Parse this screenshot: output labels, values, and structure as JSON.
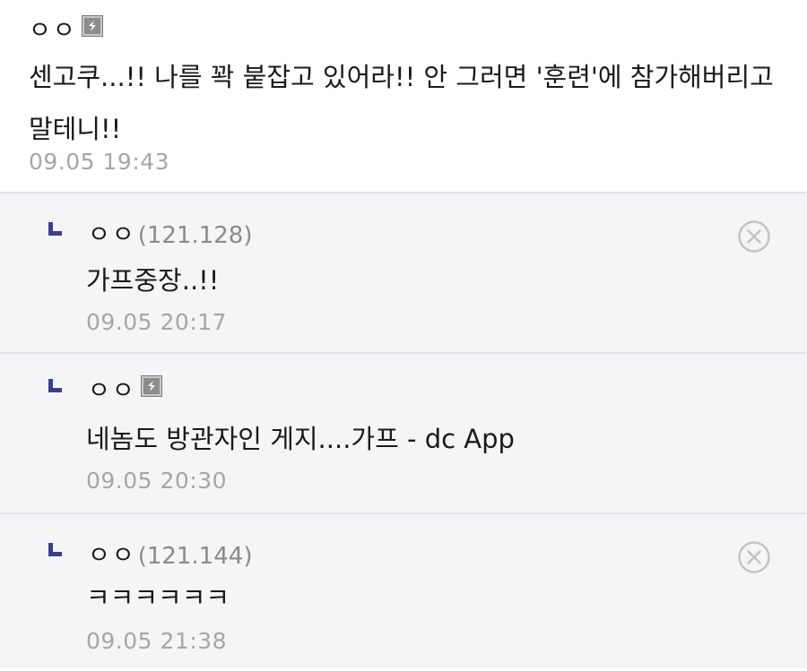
{
  "comments": [
    {
      "nickname": "ㅇㅇ",
      "ip": "",
      "has_fixed_icon": true,
      "text": "센고쿠...!! 나를 꽉 붙잡고 있어라!! 안 그러면 '훈련'에 참가해버리고 말테니!!",
      "time": "09.05 19:43"
    }
  ],
  "replies": [
    {
      "nickname": "ㅇㅇ",
      "ip": "(121.128)",
      "has_fixed_icon": false,
      "text": "가프중장..!!",
      "time": "09.05 20:17",
      "deletable": true
    },
    {
      "nickname": "ㅇㅇ",
      "ip": "",
      "has_fixed_icon": true,
      "text": "네놈도 방관자인 게지....가프 - dc App",
      "time": "09.05 20:30",
      "deletable": false
    },
    {
      "nickname": "ㅇㅇ",
      "ip": "(121.144)",
      "has_fixed_icon": false,
      "text": "ㅋㅋㅋㅋㅋㅋ",
      "time": "09.05 21:38",
      "deletable": true
    }
  ],
  "icons": {
    "reply_arrow": "reply-arrow-icon",
    "delete": "delete-circle-x-icon",
    "fixed_nick": "fixed-nickname-icon"
  },
  "colors": {
    "reply_arrow": "#3a3f8f",
    "time_text": "#a6a6a6",
    "ip_text": "#8a8a8a",
    "reply_bg": "#f5f5f7",
    "divider": "#e3e3ea"
  }
}
